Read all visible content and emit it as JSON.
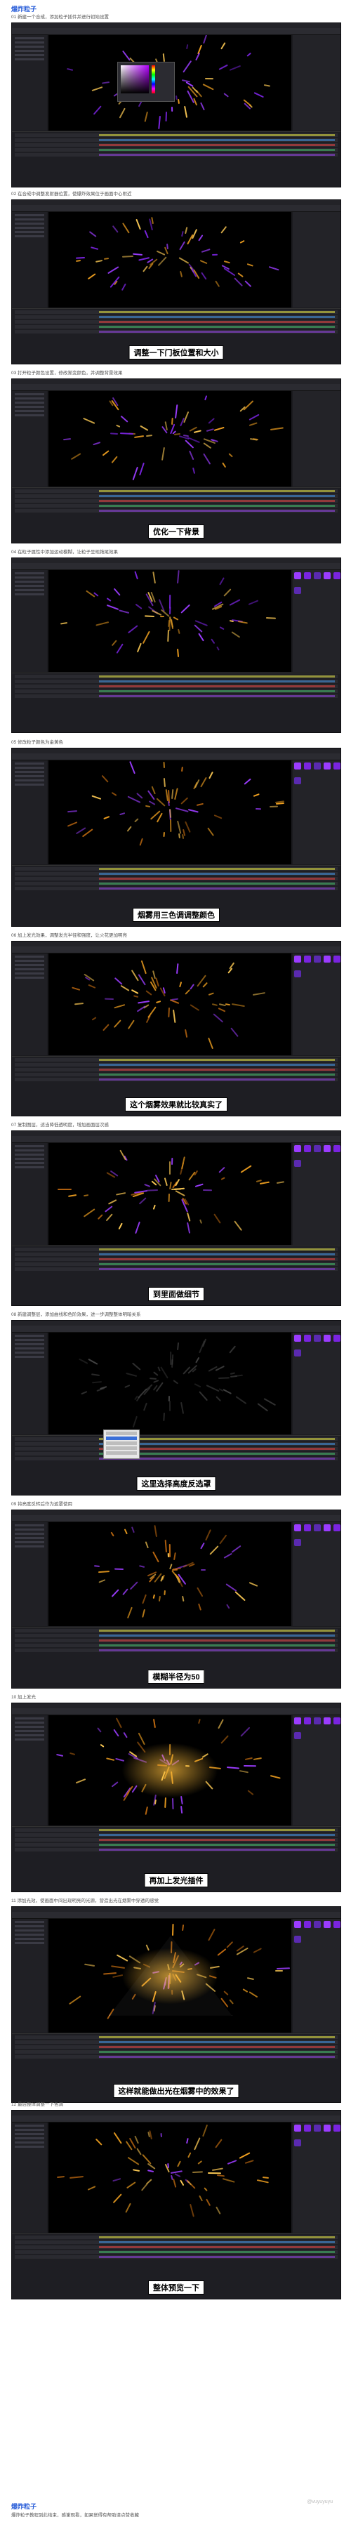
{
  "top_heading": "爆炸粒子",
  "sections": [
    {
      "note": "01 新建一个合成，添加粒子插件并进行初始设置",
      "caption": ""
    },
    {
      "note": "02 在合成中调整发射器位置，使爆炸效果位于画面中心附近",
      "caption": "调整一下门板位置和大小"
    },
    {
      "note": "03 打开粒子颜色设置，修改渐变颜色，并调整背景效果",
      "caption": "优化一下背景"
    },
    {
      "note": "04 在粒子属性中添加运动模糊，让粒子呈现拖尾效果",
      "caption": ""
    },
    {
      "note": "05 修改粒子颜色为金黄色",
      "caption": "烟雾用三色调调整颜色"
    },
    {
      "note": "06 加上发光效果，调整发光半径和强度，让火花更加明亮",
      "caption": "这个烟雾效果就比较真实了"
    },
    {
      "note": "07 复制图层，适当降低透明度，增加画面层次感",
      "caption": "到里面做细节"
    },
    {
      "note": "08 新建调整层，添加曲线和色阶效果，进一步调整整体明暗关系",
      "caption": "这里选择高度反选罩"
    },
    {
      "note": "09 将亮度反转后作为遮罩使用",
      "caption": "模糊半径为50"
    },
    {
      "note": "10 加上发光",
      "caption": "再加上发光插件"
    },
    {
      "note": "11 添加光效，使画面中间出现明亮的光源，营造出光在烟雾中穿透的感觉",
      "caption": "这样就能做出光在烟雾中的效果了"
    },
    {
      "note": "12 最后整体调整一下色调",
      "caption": "整体预览一下"
    }
  ],
  "footer_heading": "爆炸粒子",
  "footer_note": "爆炸粒子教程到此结束，感谢观看，如果觉得有帮助请点赞收藏",
  "watermark": "@vuyuyuyu",
  "colors": {
    "heading": "#2b5fd9",
    "accent_purple": "#9b3cff",
    "accent_gold": "#f0a020"
  }
}
